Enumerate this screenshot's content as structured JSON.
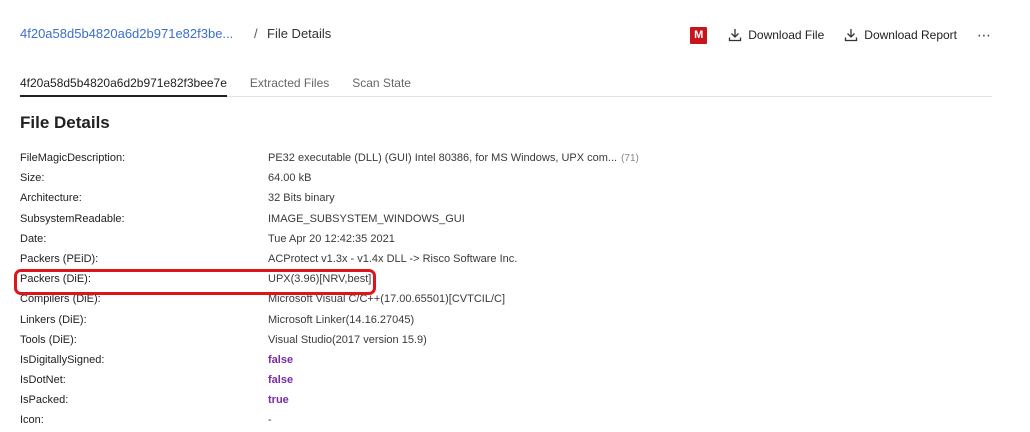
{
  "breadcrumb": {
    "hash_link": "4f20a58d5b4820a6d2b971e82f3be...",
    "separator": "/",
    "current": "File Details"
  },
  "actions": {
    "badge": "M",
    "download_file": "Download File",
    "download_report": "Download Report",
    "more": "⋯"
  },
  "tabs": [
    {
      "label": "4f20a58d5b4820a6d2b971e82f3bee7e"
    },
    {
      "label": "Extracted Files"
    },
    {
      "label": "Scan State"
    }
  ],
  "section_title": "File Details",
  "details": [
    {
      "key": "FileMagicDescription:",
      "value": "PE32 executable (DLL) (GUI) Intel 80386, for MS Windows, UPX com...",
      "count": "(71)"
    },
    {
      "key": "Size:",
      "value": "64.00 kB"
    },
    {
      "key": "Architecture:",
      "value": "32 Bits binary"
    },
    {
      "key": "SubsystemReadable:",
      "value": "IMAGE_SUBSYSTEM_WINDOWS_GUI"
    },
    {
      "key": "Date:",
      "value": "Tue Apr 20 12:42:35 2021"
    },
    {
      "key": "Packers (PEiD):",
      "value": "ACProtect v1.3x - v1.4x DLL -> Risco Software Inc."
    },
    {
      "key": "Packers (DiE):",
      "value": "UPX(3.96)[NRV,best]"
    },
    {
      "key": "Compilers (DiE):",
      "value": "Microsoft Visual C/C++(17.00.65501)[CVTCIL/C]"
    },
    {
      "key": "Linkers (DiE):",
      "value": "Microsoft Linker(14.16.27045)"
    },
    {
      "key": "Tools (DiE):",
      "value": "Visual Studio(2017 version 15.9)"
    },
    {
      "key": "IsDigitallySigned:",
      "value": "false"
    },
    {
      "key": "IsDotNet:",
      "value": "false"
    },
    {
      "key": "IsPacked:",
      "value": "true"
    },
    {
      "key": "Icon:",
      "value": "-"
    }
  ]
}
